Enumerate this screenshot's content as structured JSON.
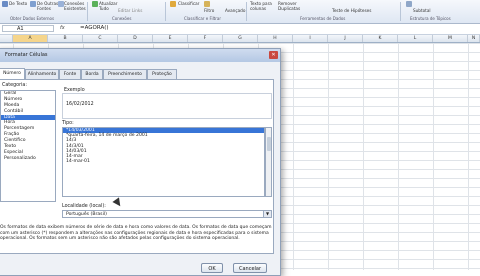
{
  "ribbon": {
    "items": [
      {
        "id": "de-texto",
        "label": "De Texto"
      },
      {
        "id": "de-outras-fontes",
        "label": "De Outras\nFontes"
      },
      {
        "id": "conexoes-existentes",
        "label": "Conexões\nExistentes"
      },
      {
        "id": "atualizar-tudo",
        "label": "Atualizar\nTudo"
      },
      {
        "id": "editar-links",
        "label": "Editar Links"
      },
      {
        "id": "classificar",
        "label": "Classificar"
      },
      {
        "id": "filtro",
        "label": "Filtro"
      },
      {
        "id": "avancado",
        "label": "Avançado"
      },
      {
        "id": "texto-para-colunas",
        "label": "Texto para\ncolunas"
      },
      {
        "id": "remover-duplicatas",
        "label": "Remover\nDuplicatas"
      },
      {
        "id": "teste-hipoteses",
        "label": "Teste de Hipóteses"
      },
      {
        "id": "subtotal",
        "label": "Subtotal"
      }
    ],
    "groups": [
      {
        "id": "obter-dados",
        "label": "Obter Dados Externos"
      },
      {
        "id": "conexoes",
        "label": "Conexões"
      },
      {
        "id": "classificar-filtrar",
        "label": "Classificar e Filtrar"
      },
      {
        "id": "ferramentas-dados",
        "label": "Ferramentas de Dados"
      },
      {
        "id": "estrutura-topicos",
        "label": "Estrutura de Tópicos"
      }
    ]
  },
  "formula_bar": {
    "cell": "A1",
    "fx": "fx",
    "formula": "=AGORA()"
  },
  "columns": [
    "A",
    "B",
    "C",
    "D",
    "E",
    "F",
    "G",
    "H",
    "I",
    "J",
    "K",
    "L",
    "M",
    "N"
  ],
  "dialog": {
    "title": "Formatar Células",
    "close": "✕",
    "tabs": [
      "Número",
      "Alinhamento",
      "Fonte",
      "Borda",
      "Preenchimento",
      "Proteção"
    ],
    "category_label": "Categoria:",
    "categories": [
      "Geral",
      "Número",
      "Moeda",
      "Contábil",
      "Data",
      "Hora",
      "Porcentagem",
      "Fração",
      "Científico",
      "Texto",
      "Especial",
      "Personalizado"
    ],
    "selected_category": "Data",
    "example_label": "Exemplo",
    "example_value": "16/02/2012",
    "type_label": "Tipo:",
    "types": [
      "*14/03/2001",
      "*quarta-feira, 14 de março de 2001",
      "14/3",
      "14/3/01",
      "14/03/01",
      "14-mar",
      "14-mar-01"
    ],
    "selected_type": "*14/03/2001",
    "locale_label": "Localidade (local):",
    "locale_value": "Português (Brasil)",
    "description": "Os formatos de data exibem números de série de data e hora como valores de data. Os formatos de data que começam com um asterisco (*) respondem a alterações nas configurações regionais de data e hora especificadas para o sistema operacional. Os formatos sem um asterisco não são afetados pelas configurações do sistema operacional.",
    "ok": "OK",
    "cancel": "Cancelar"
  }
}
